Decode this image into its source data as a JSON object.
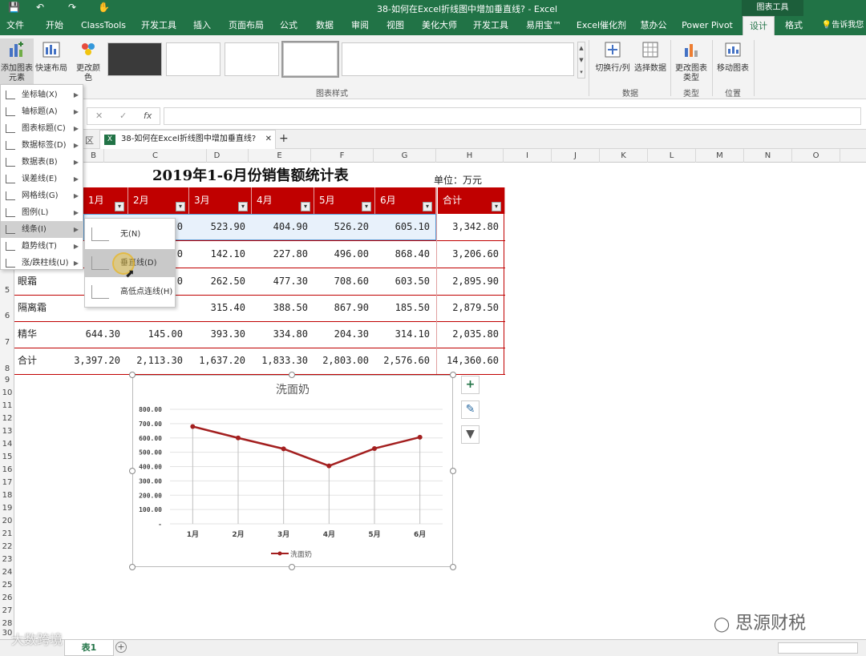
{
  "titlebar": {
    "title": "38-如何在Excel折线图中增加垂直线? - Excel",
    "context_tab": "图表工具"
  },
  "tabs": [
    "文件",
    "开始",
    "ClassTools",
    "开发工具",
    "插入",
    "页面布局",
    "公式",
    "数据",
    "审阅",
    "视图",
    "美化大师",
    "开发工具",
    "易用宝™",
    "Excel催化剂",
    "慧办公",
    "Power Pivot",
    "设计",
    "格式"
  ],
  "tell_me": "告诉我您",
  "ribbon": {
    "add_element": "添加图表元素",
    "quick_layout": "快速布局",
    "change_color": "更改颜色",
    "styles_group": "图表样式",
    "switch_row_col": "切换行/列",
    "select_data": "选择数据",
    "data_group": "数据",
    "change_type": "更改图表类型",
    "type_group": "类型",
    "move_chart": "移动图表",
    "location_group": "位置"
  },
  "formula": {
    "fx": "fx",
    "cancel": "✕",
    "confirm": "✓"
  },
  "workbook_tab": {
    "label": "38-如何在Excel折线图中增加垂直线?",
    "prev": "区"
  },
  "columns": [
    "B",
    "C",
    "D",
    "E",
    "F",
    "G",
    "H",
    "I",
    "J",
    "K",
    "L",
    "M",
    "N",
    "O"
  ],
  "rows": [
    "5",
    "6",
    "7",
    "8",
    "9",
    "10",
    "11",
    "12",
    "13",
    "14",
    "15",
    "16",
    "17",
    "18",
    "19",
    "20",
    "21",
    "22",
    "23",
    "24",
    "25",
    "26",
    "27",
    "28",
    "29",
    "30"
  ],
  "sheet": {
    "title": "2019年1-6月份销售额统计表",
    "unit": "单位：万元",
    "headers": [
      "1月",
      "2月",
      "3月",
      "4月",
      "5月",
      "6月",
      "合计"
    ],
    "rows": [
      {
        "name": "",
        "values": [
          "0",
          "523.90",
          "404.90",
          "526.20",
          "605.10",
          "3,342.80"
        ]
      },
      {
        "name": "",
        "values": [
          "0",
          "142.10",
          "227.80",
          "496.00",
          "868.40",
          "3,206.60"
        ]
      },
      {
        "name": "眼霜",
        "values": [
          "0",
          "262.50",
          "477.30",
          "708.60",
          "603.50",
          "2,895.90"
        ]
      },
      {
        "name": "隔离霜",
        "values": [
          "",
          "315.40",
          "388.50",
          "867.90",
          "185.50",
          "2,879.50"
        ]
      },
      {
        "name": "精华",
        "values": [
          "644.30",
          "145.00",
          "393.30",
          "334.80",
          "204.30",
          "314.10",
          "2,035.80"
        ]
      },
      {
        "name": "合计",
        "values": [
          "3,397.20",
          "2,113.30",
          "1,637.20",
          "1,833.30",
          "2,803.00",
          "2,576.60",
          "14,360.60"
        ]
      }
    ]
  },
  "menu": {
    "items": [
      {
        "label": "坐标轴(X)"
      },
      {
        "label": "轴标题(A)"
      },
      {
        "label": "图表标题(C)"
      },
      {
        "label": "数据标签(D)"
      },
      {
        "label": "数据表(B)"
      },
      {
        "label": "误差线(E)"
      },
      {
        "label": "网格线(G)"
      },
      {
        "label": "图例(L)"
      },
      {
        "label": "线条(I)"
      },
      {
        "label": "趋势线(T)"
      },
      {
        "label": "涨/跌柱线(U)"
      }
    ],
    "submenu": [
      {
        "label": "无(N)"
      },
      {
        "label": "垂直线(D)"
      },
      {
        "label": "高低点连线(H)"
      }
    ]
  },
  "chart_data": {
    "type": "line",
    "title": "洗面奶",
    "categories": [
      "1月",
      "2月",
      "3月",
      "4月",
      "5月",
      "6月"
    ],
    "series": [
      {
        "name": "洗面奶",
        "values": [
          680.0,
          600.0,
          523.9,
          404.9,
          526.2,
          605.1
        ]
      }
    ],
    "y_ticks": [
      "-",
      "100.00",
      "200.00",
      "300.00",
      "400.00",
      "500.00",
      "600.00",
      "700.00",
      "800.00"
    ],
    "ylim": [
      0,
      800
    ],
    "grid": true,
    "drop_lines": true,
    "legend": "bottom",
    "line_color": "#a31f1f"
  },
  "chart_tools": {
    "add": "+",
    "style": "✎",
    "filter": "▼"
  },
  "sheet_tab": "表1",
  "watermark": {
    "left": "大数跨境",
    "right": "思源财税"
  }
}
